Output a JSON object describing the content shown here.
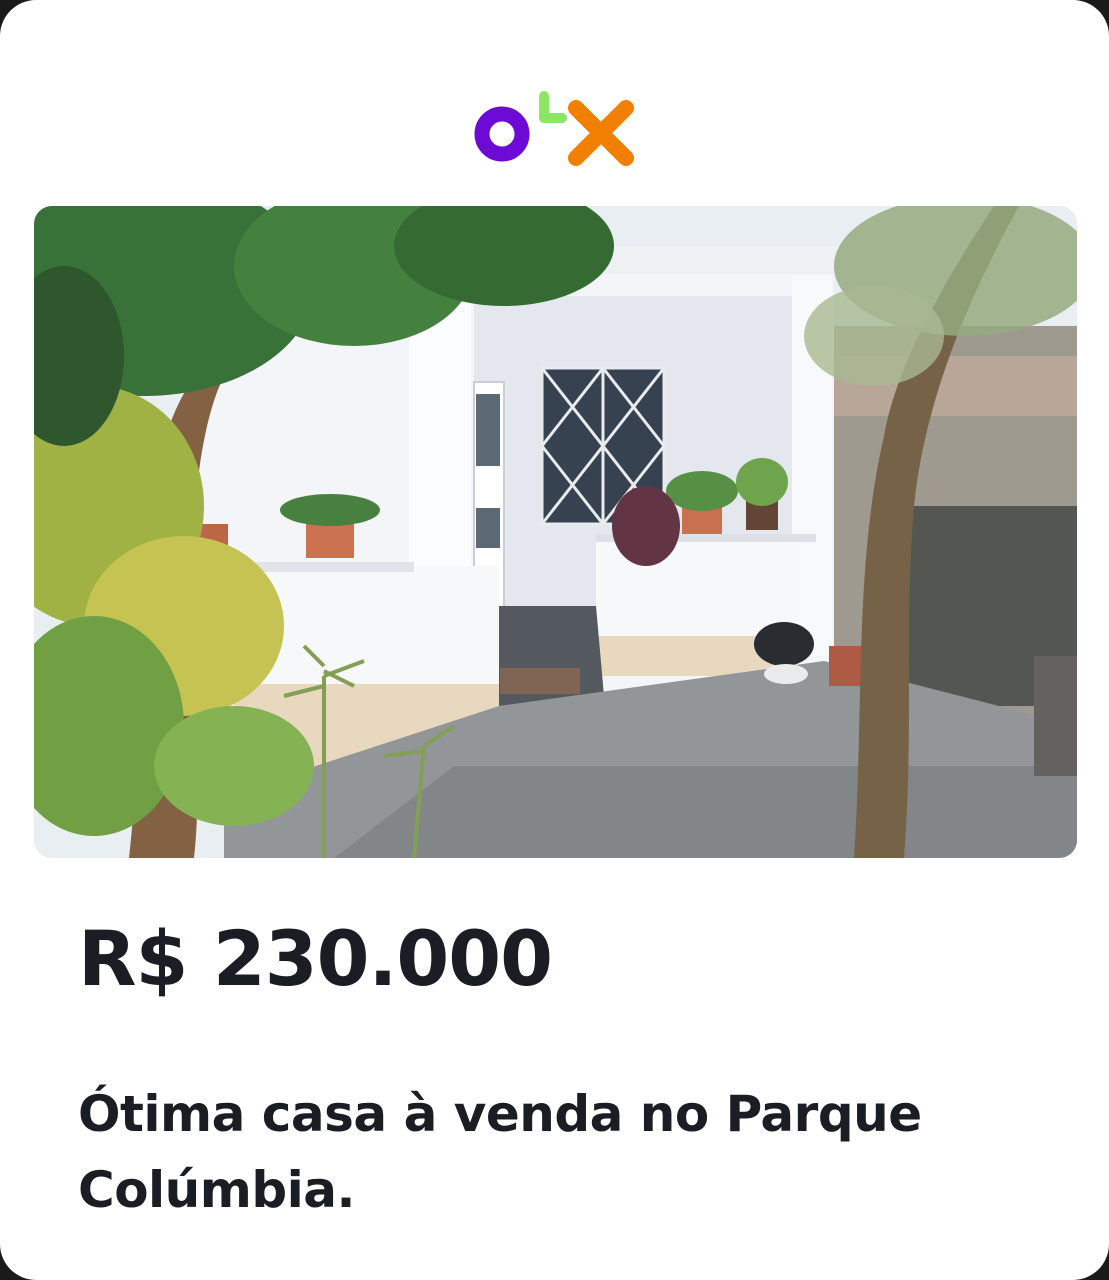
{
  "brand": {
    "name": "OLX",
    "letters": [
      "o",
      "L",
      "x"
    ],
    "colors": {
      "purple": "#6e0ad6",
      "green": "#8ce563",
      "orange": "#f28000"
    }
  },
  "listing": {
    "price": "R$ 230.000",
    "title": "Ótima casa à venda no Parque Colúmbia."
  },
  "colors": {
    "text": "#1a1d24",
    "card_background": "#ffffff"
  }
}
